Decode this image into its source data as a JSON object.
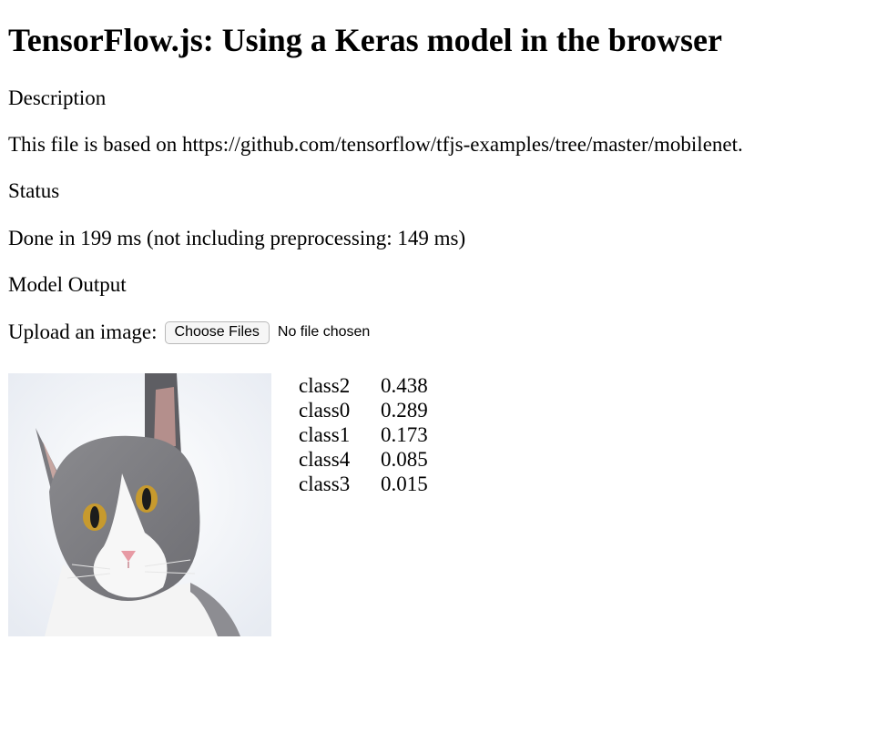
{
  "page": {
    "title": "TensorFlow.js: Using a Keras model in the browser",
    "description_heading": "Description",
    "description_text": "This file is based on https://github.com/tensorflow/tfjs-examples/tree/master/mobilenet.",
    "status_heading": "Status",
    "status_text": "Done in 199 ms (not including preprocessing: 149 ms)",
    "output_heading": "Model Output"
  },
  "upload": {
    "label": "Upload an image:",
    "button_label": "Choose Files",
    "file_status": "No file chosen"
  },
  "preview": {
    "icon": "cat-photo"
  },
  "predictions": [
    {
      "class": "class2",
      "probability": "0.438"
    },
    {
      "class": "class0",
      "probability": "0.289"
    },
    {
      "class": "class1",
      "probability": "0.173"
    },
    {
      "class": "class4",
      "probability": "0.085"
    },
    {
      "class": "class3",
      "probability": "0.015"
    }
  ]
}
